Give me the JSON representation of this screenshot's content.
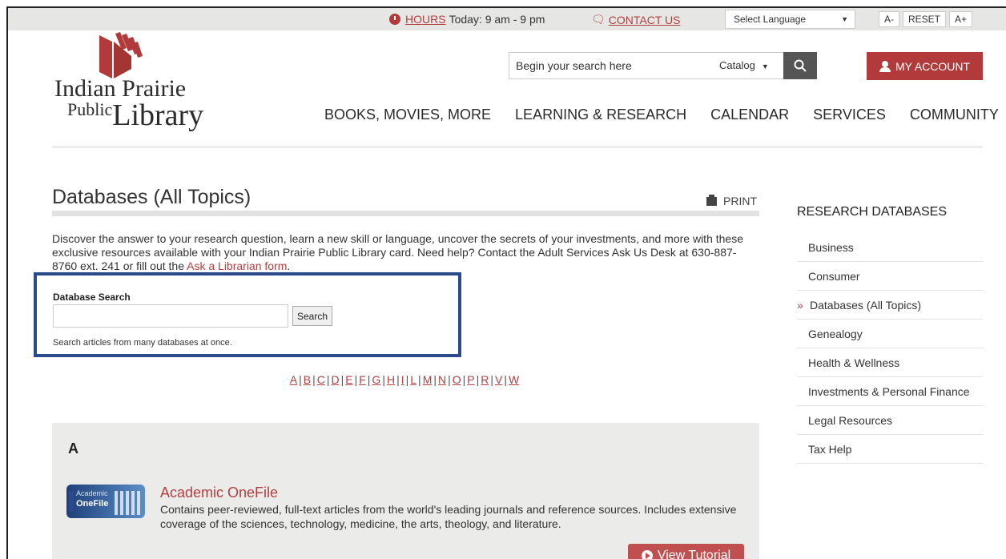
{
  "topbar": {
    "hours_link": "HOURS",
    "hours_text": "Today: 9 am - 9 pm",
    "contact_link": "CONTACT US",
    "language_select": "Select Language",
    "font_decrease": "A-",
    "font_reset": "RESET",
    "font_increase": "A+"
  },
  "logo": {
    "line1": "Indian Prairie",
    "line2_small": "Public",
    "line2_large": "Library"
  },
  "search": {
    "placeholder": "Begin your search here",
    "scope": "Catalog"
  },
  "account": {
    "label": "MY ACCOUNT"
  },
  "nav": {
    "items": [
      "BOOKS, MOVIES, MORE",
      "LEARNING & RESEARCH",
      "CALENDAR",
      "SERVICES",
      "COMMUNITY"
    ]
  },
  "page": {
    "title": "Databases (All Topics)",
    "print_label": "PRINT",
    "intro_text": "Discover the answer to your research question, learn a new skill or language, uncover the secrets of your investments, and more with these exclusive resources available with your Indian Prairie Public Library card. Need help? Contact the Adult Services Ask Us Desk at 630-887-8760 ext. 241 or fill out the ",
    "intro_link": "Ask a Librarian form",
    "intro_end": "."
  },
  "db_search": {
    "label": "Database Search",
    "button": "Search",
    "help": "Search articles from many databases at once."
  },
  "alphabet": [
    "A",
    "B",
    "C",
    "D",
    "E",
    "F",
    "G",
    "H",
    "I",
    "L",
    "M",
    "N",
    "O",
    "P",
    "R",
    "V",
    "W"
  ],
  "section": {
    "letter": "A",
    "resource": {
      "thumb_line1": "Academic",
      "thumb_line2": "OneFile",
      "title": "Academic OneFile",
      "description": "Contains peer-reviewed, full-text articles from the world's leading journals and reference sources. Includes extensive coverage of the sciences, technology, medicine, the arts, theology, and literature.",
      "tutorial_label": "View Tutorial"
    }
  },
  "sidebar": {
    "title": "RESEARCH DATABASES",
    "items": [
      {
        "label": "Business"
      },
      {
        "label": "Consumer"
      },
      {
        "label": "Databases (All Topics)",
        "active": true,
        "marker": "»"
      },
      {
        "label": "Genealogy"
      },
      {
        "label": "Health & Wellness"
      },
      {
        "label": "Investments & Personal Finance"
      },
      {
        "label": "Legal Resources"
      },
      {
        "label": "Tax Help"
      }
    ]
  },
  "colors": {
    "brand_red": "#b23a3a",
    "link_red": "#b04040",
    "highlight_box": "#2b4a8b"
  }
}
